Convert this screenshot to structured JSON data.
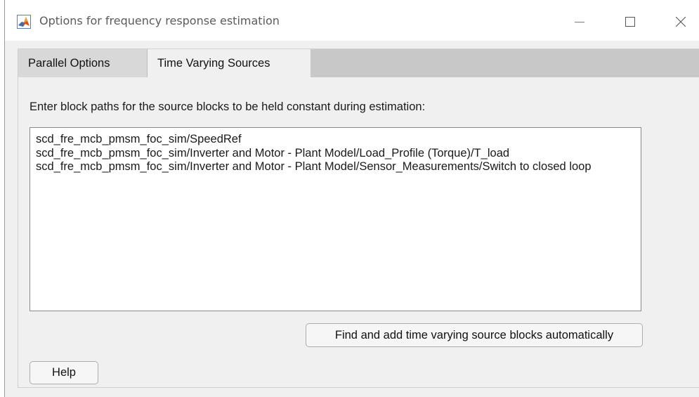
{
  "window": {
    "title": "Options for frequency response estimation",
    "icon": "matlab-logo-icon",
    "controls": [
      "minimize-icon",
      "maximize-icon",
      "close-icon"
    ]
  },
  "tabs": [
    {
      "label": "Parallel Options",
      "selected": false
    },
    {
      "label": "Time Varying Sources",
      "selected": true
    }
  ],
  "content": {
    "instruction": "Enter block paths for the source blocks to be held constant during estimation:",
    "paths_text": "scd_fre_mcb_pmsm_foc_sim/SpeedRef\nscd_fre_mcb_pmsm_foc_sim/Inverter and Motor - Plant Model/Load_Profile (Torque)/T_load\nscd_fre_mcb_pmsm_foc_sim/Inverter and Motor - Plant Model/Sensor_Measurements/Switch to closed loop",
    "find_button": "Find and add time varying source blocks automatically",
    "help_button": "Help"
  }
}
